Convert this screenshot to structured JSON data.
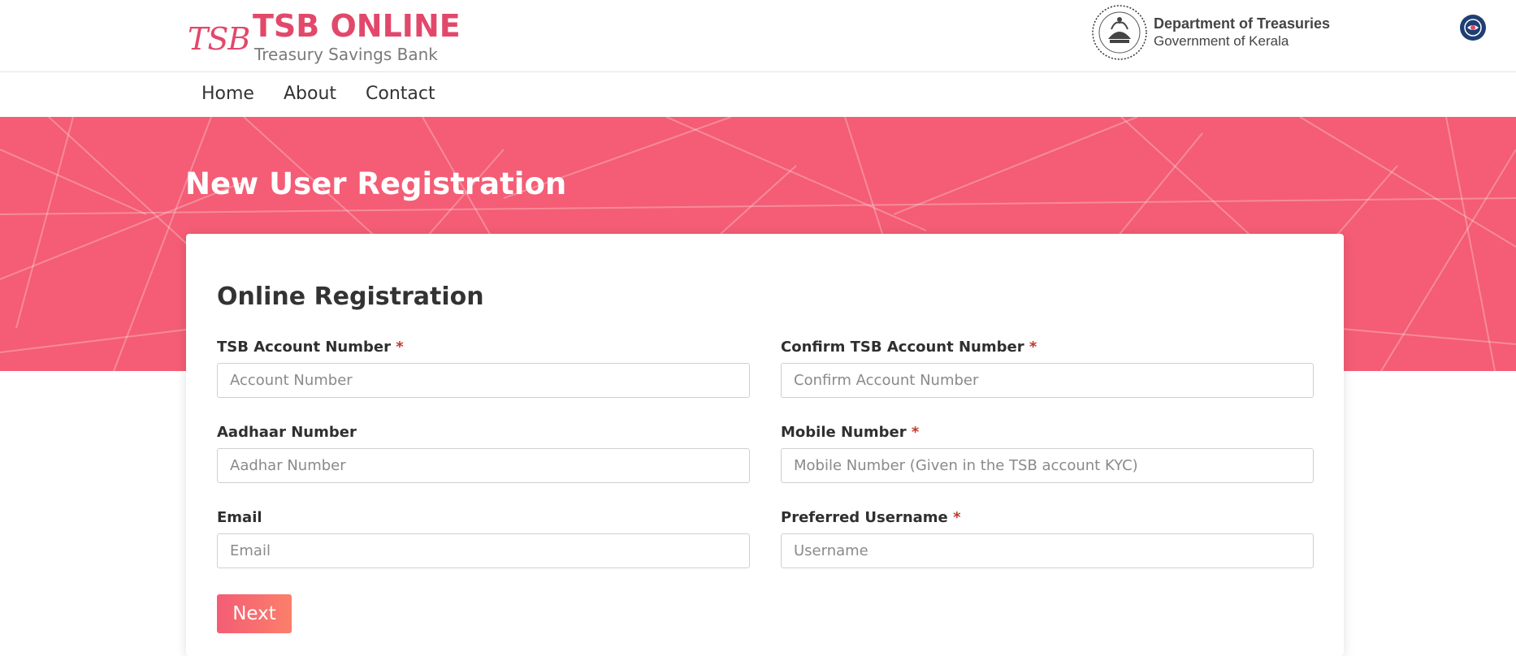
{
  "header": {
    "brand_script": "TSB",
    "brand_title": "TSB ONLINE",
    "brand_subtitle": "Treasury Savings Bank",
    "dept_title": "Department of Treasuries",
    "dept_subtitle": "Government of Kerala",
    "emblem_icon": "kerala-emblem-icon",
    "accessibility_icon": "eye-icon"
  },
  "nav": {
    "items": [
      {
        "label": "Home"
      },
      {
        "label": "About"
      },
      {
        "label": "Contact"
      }
    ]
  },
  "hero": {
    "title": "New User Registration"
  },
  "form": {
    "title": "Online Registration",
    "required_mark": "*",
    "fields": {
      "account_number": {
        "label": "TSB Account Number",
        "placeholder": "Account Number",
        "value": ""
      },
      "confirm_account_number": {
        "label": "Confirm TSB Account Number",
        "placeholder": "Confirm Account Number",
        "value": ""
      },
      "aadhaar_number": {
        "label": "Aadhaar Number",
        "placeholder": "Aadhar Number",
        "value": ""
      },
      "mobile_number": {
        "label": "Mobile Number",
        "placeholder": "Mobile Number (Given in the TSB account KYC)",
        "value": ""
      },
      "email": {
        "label": "Email",
        "placeholder": "Email",
        "value": ""
      },
      "username": {
        "label": "Preferred Username",
        "placeholder": "Username",
        "value": ""
      }
    },
    "next_label": "Next"
  },
  "colors": {
    "brand_pink": "#e2486a",
    "hero_bg": "#f45d75",
    "button_gradient_end": "#fb7f6a",
    "required_red": "#c0392b",
    "accessibility_blue": "#1f3f73"
  }
}
